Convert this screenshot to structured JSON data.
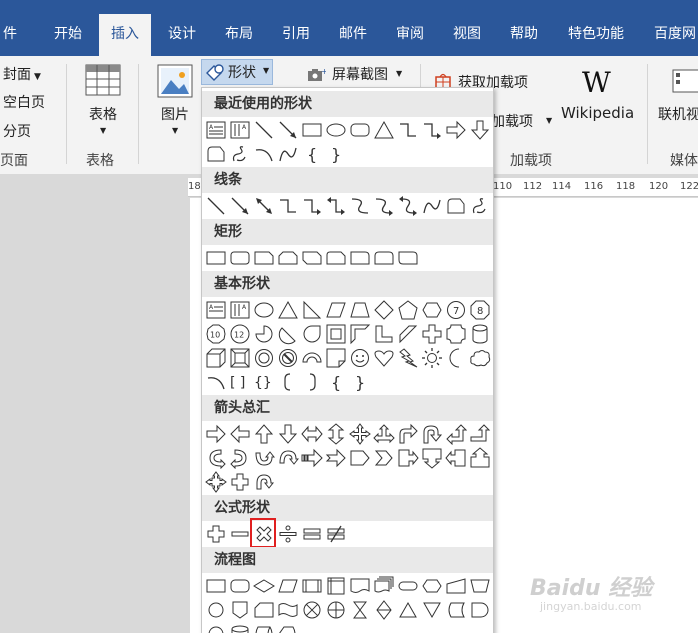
{
  "tabs": [
    "件",
    "开始",
    "插入",
    "设计",
    "布局",
    "引用",
    "邮件",
    "审阅",
    "视图",
    "帮助",
    "特色功能",
    "百度网"
  ],
  "ribbon": {
    "cover": "封面",
    "blank_page": "空白页",
    "page_break": "分页",
    "pages_group": "页面",
    "table": "表格",
    "tables_group": "表格",
    "picture": "图片",
    "shapes": "形状",
    "screenshot": "屏幕截图",
    "get_addins": "获取加载项",
    "my_addins": "加载项",
    "wikipedia_logo": "W",
    "wikipedia": "Wikipedia",
    "addins_group": "加载项",
    "online_video": "联机视",
    "media_group": "媒体"
  },
  "ruler": [
    "18",
    "110",
    "112",
    "114",
    "116",
    "118",
    "120",
    "122"
  ],
  "dropdown": {
    "recent": "最近使用的形状",
    "lines": "线条",
    "rectangles": "矩形",
    "basic": "基本形状",
    "arrows": "箭头总汇",
    "equation": "公式形状",
    "flowchart": "流程图"
  },
  "watermark": {
    "brand": "Baidu 经验",
    "url": "jingyan.baidu.com"
  }
}
